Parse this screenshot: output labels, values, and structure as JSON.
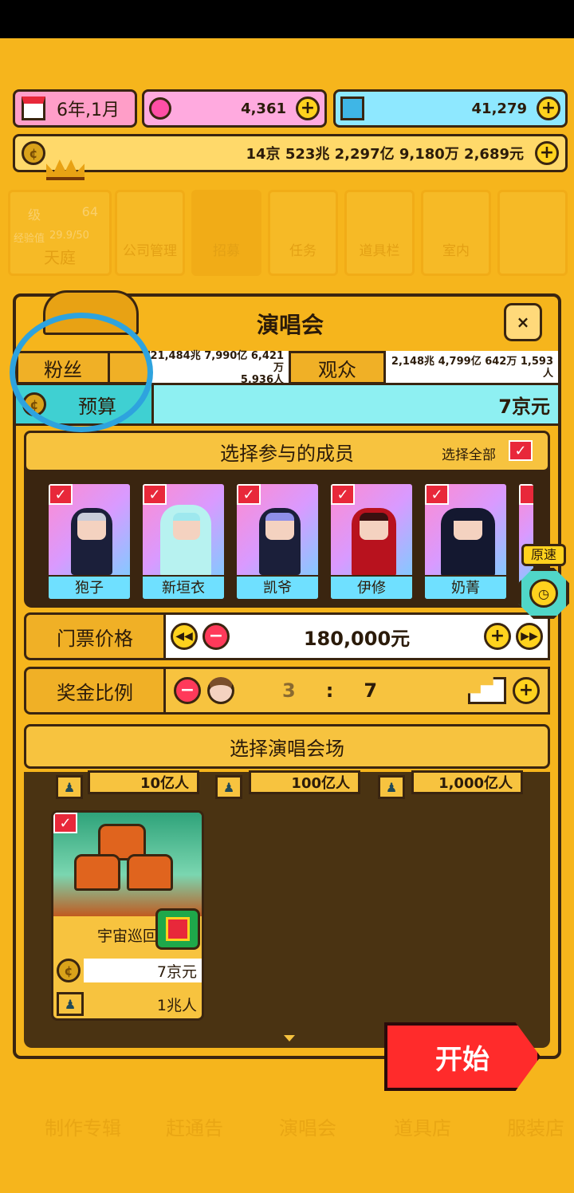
{
  "top_bar": {
    "date": "6年,1月",
    "pink_currency": "4,361",
    "blue_currency": "41,279",
    "money": "14京 523兆 2,297亿 9,180万 2,689元"
  },
  "nav_bg": {
    "level_label": "级",
    "level_value": "64",
    "exp_label": "经验值",
    "exp_value": "29.9/50",
    "tiles": [
      "天庭",
      "公司管理",
      "招募",
      "任务",
      "道具栏",
      "室内"
    ]
  },
  "modal": {
    "title": "演唱会",
    "close": "×",
    "fans_label": "粉丝",
    "fans_value_line1": "21,484兆 7,990亿 6,421万",
    "fans_value_line2": "5,936人",
    "audience_label": "观众",
    "audience_value": "2,148兆 4,799亿 642万 1,593人",
    "budget_label": "预算",
    "budget_value": "7京元"
  },
  "members": {
    "header": "选择参与的成员",
    "select_all": "选择全部",
    "list": [
      {
        "name": "狍子",
        "selected": true
      },
      {
        "name": "新垣衣",
        "selected": true
      },
      {
        "name": "凯爷",
        "selected": true
      },
      {
        "name": "伊修",
        "selected": true
      },
      {
        "name": "奶菁",
        "selected": true
      }
    ]
  },
  "ticket": {
    "label": "门票价格",
    "value": "180,000元"
  },
  "bonus": {
    "label": "奖金比例",
    "left": "3",
    "sep": ":",
    "right": "7"
  },
  "venue": {
    "header": "选择演唱会场",
    "capacities": [
      "10亿人",
      "100亿人",
      "1,000亿人"
    ],
    "selected_venue": {
      "name": "宇宙巡回",
      "cost": "7京元",
      "capacity": "1兆人"
    }
  },
  "speed_label": "原速",
  "start_button": "开始",
  "bottom_nav": [
    "制作专辑",
    "赶通告",
    "演唱会",
    "道具店",
    "服装店"
  ],
  "colors": {
    "background": "#f6b51c",
    "accent_red": "#ff2b2b",
    "cyan": "#6fe0ff",
    "highlight_circle": "#2ea3de"
  }
}
